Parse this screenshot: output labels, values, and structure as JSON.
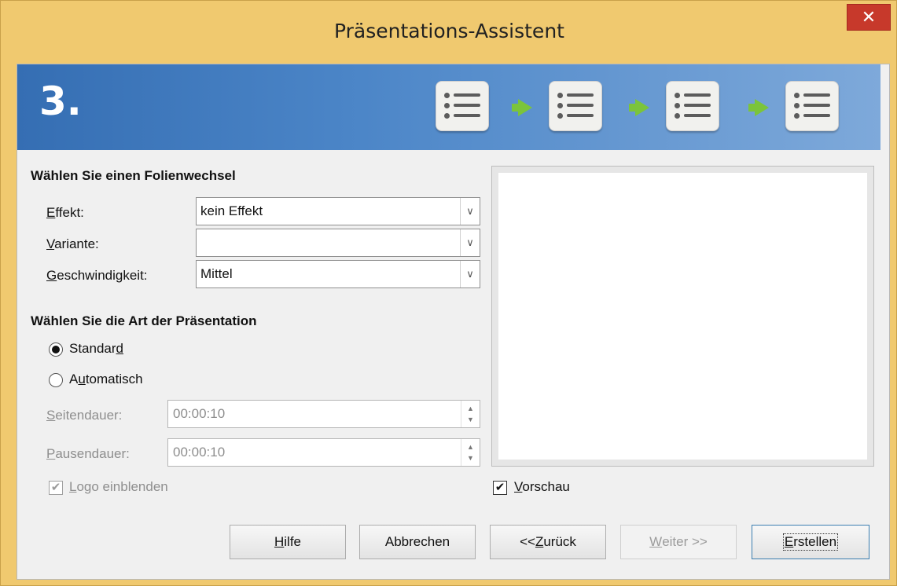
{
  "window": {
    "title": "Präsentations-Assistent",
    "close_glyph": "✕"
  },
  "banner": {
    "step_number": "3.",
    "icons": [
      "list-icon",
      "list-icon",
      "list-icon",
      "list-icon"
    ],
    "arrow_icon": "arrow-right-icon",
    "accent_color": "#4c86c8"
  },
  "transition": {
    "heading": "Wählen Sie einen Folienwechsel",
    "effect_label_mnemonic": "E",
    "effect_label_rest": "ffekt:",
    "effect_value": "kein Effekt",
    "variant_label_mnemonic": "V",
    "variant_label_rest": "ariante:",
    "variant_value": "",
    "speed_label_mnemonic": "G",
    "speed_label_rest": "eschwindigkeit:",
    "speed_value": "Mittel"
  },
  "presentation_type": {
    "heading": "Wählen Sie die Art der Präsentation",
    "standard_label_pre": "Standar",
    "standard_label_mnemonic": "d",
    "standard_selected": true,
    "automatic_label_pre": "A",
    "automatic_label_mnemonic": "u",
    "automatic_label_rest": "tomatisch",
    "page_duration_label_mnemonic": "S",
    "page_duration_label_rest": "eitendauer:",
    "page_duration_value": "00:00:10",
    "pause_duration_label_mnemonic": "P",
    "pause_duration_label_rest": "ausendauer:",
    "pause_duration_value": "00:00:10",
    "logo_label_mnemonic": "L",
    "logo_label_rest": "ogo einblenden",
    "logo_checked": true
  },
  "preview": {
    "label_mnemonic": "V",
    "label_rest": "orschau",
    "checked": true
  },
  "buttons": {
    "help_mnemonic": "H",
    "help_rest": "ilfe",
    "cancel": "Abbrechen",
    "back_pre": "<< ",
    "back_mnemonic": "Z",
    "back_rest": "urück",
    "next_mnemonic": "W",
    "next_rest": "eiter >>",
    "create_mnemonic": "E",
    "create_rest": "rstellen"
  }
}
